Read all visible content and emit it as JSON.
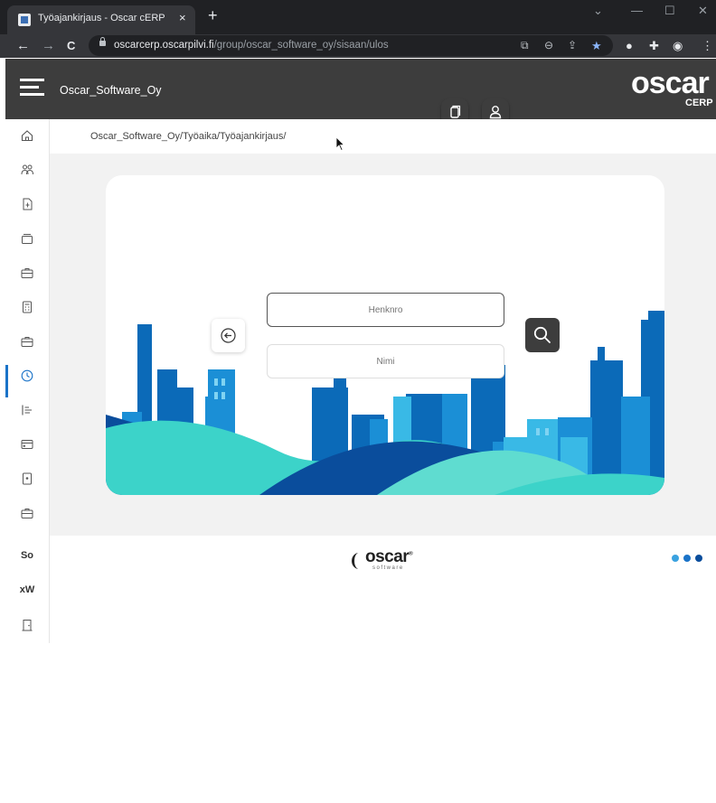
{
  "browser": {
    "tab_title": "Työajankirjaus - Oscar cERP",
    "tab_close": "×",
    "new_tab": "+",
    "url_host": "oscarcerp.oscarpilvi.fi",
    "url_path": "/group/oscar_software_oy/sisaan/ulos",
    "back": "←",
    "forward": "→",
    "reload": "C"
  },
  "header": {
    "company": "Oscar_Software_Oy",
    "logo_main": "oscar",
    "logo_sub": "CERP"
  },
  "sidebar": {
    "text_items": [
      "So",
      "xW"
    ],
    "icons": [
      "home-icon",
      "users-icon",
      "document-icon",
      "inbox-icon",
      "briefcase-icon",
      "calculator-icon",
      "briefcase-icon",
      "clock-icon",
      "list-icon",
      "card-icon",
      "bookmark-icon",
      "briefcase-icon",
      "door-icon"
    ]
  },
  "breadcrumb": "Oscar_Software_Oy/Työaika/Työajankirjaus/",
  "form": {
    "henknro_placeholder": "Henknro",
    "nimi_placeholder": "Nimi"
  },
  "footer": {
    "logo_main": "oscar",
    "logo_sub": "software",
    "logo_mark": "®"
  },
  "colors": {
    "header_bg": "#3d3d3d",
    "accent": "#1a73c8",
    "skyline_blue": "#1b8fd6",
    "skyline_teal": "#3cd3c9"
  }
}
